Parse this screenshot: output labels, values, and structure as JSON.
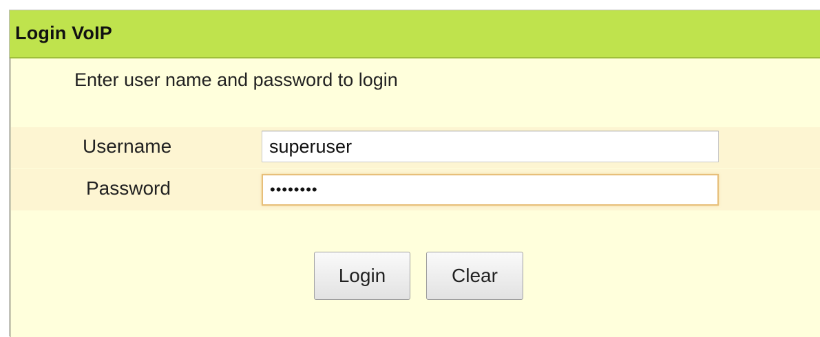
{
  "window": {
    "title": "Login VoIP"
  },
  "form": {
    "instruction": "Enter user name and password to login",
    "username_label": "Username",
    "username_value": "superuser",
    "password_label": "Password",
    "password_value": "12345678"
  },
  "buttons": {
    "login_label": "Login",
    "clear_label": "Clear"
  },
  "colors": {
    "header_bg": "#bfe34d",
    "panel_bg": "#ffffdc",
    "row_bg": "#fdf5d2",
    "focus_border": "#e7bf7a"
  }
}
